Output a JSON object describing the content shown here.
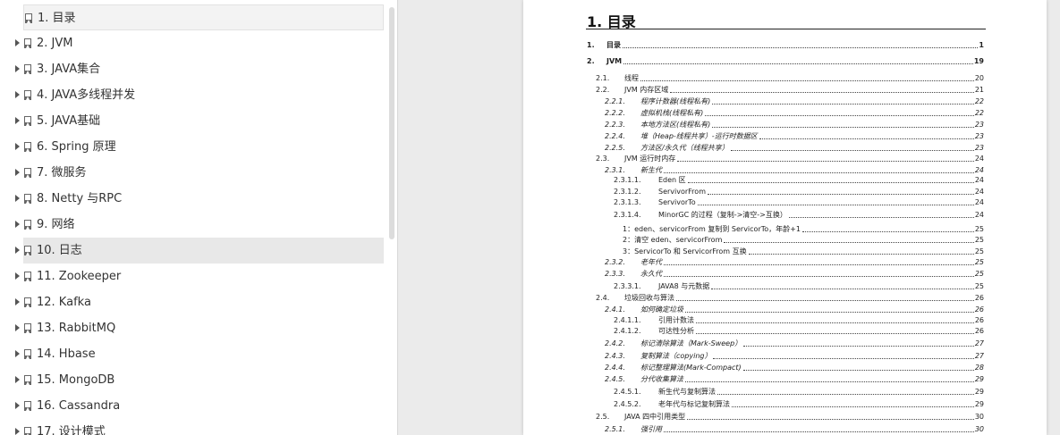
{
  "sidebar": {
    "items": [
      {
        "label": "1. 目录",
        "expandable": false,
        "state": "selected"
      },
      {
        "label": "2. JVM",
        "expandable": true
      },
      {
        "label": "3. JAVA集合",
        "expandable": true
      },
      {
        "label": "4. JAVA多线程并发",
        "expandable": true
      },
      {
        "label": "5. JAVA基础",
        "expandable": true
      },
      {
        "label": "6. Spring 原理",
        "expandable": true
      },
      {
        "label": "7.   微服务",
        "expandable": true
      },
      {
        "label": "8. Netty 与RPC",
        "expandable": true
      },
      {
        "label": "9. 网络",
        "expandable": true
      },
      {
        "label": "10. 日志",
        "expandable": true,
        "state": "hovered"
      },
      {
        "label": "11. Zookeeper",
        "expandable": true
      },
      {
        "label": "12. Kafka",
        "expandable": true
      },
      {
        "label": "13. RabbitMQ",
        "expandable": true
      },
      {
        "label": "14. Hbase",
        "expandable": true
      },
      {
        "label": "15. MongoDB",
        "expandable": true
      },
      {
        "label": "16. Cassandra",
        "expandable": true
      },
      {
        "label": "17. 设计模式",
        "expandable": true
      }
    ]
  },
  "document": {
    "title": "1. 目录",
    "toc": [
      {
        "num": "1.",
        "text": "目录",
        "page": "1",
        "style": "b",
        "level": 1
      },
      {
        "num": "2.",
        "text": "JVM",
        "page": "19",
        "style": "b",
        "level": 1
      },
      {
        "num": "2.1.",
        "text": "线程",
        "page": "20",
        "style": "",
        "level": 2
      },
      {
        "num": "2.2.",
        "text": "JVM 内存区域",
        "page": "21",
        "style": "",
        "level": 2
      },
      {
        "num": "2.2.1.",
        "text": "程序计数器(线程私有)",
        "page": "22",
        "style": "i",
        "level": 3
      },
      {
        "num": "2.2.2.",
        "text": "虚拟机栈(线程私有)",
        "page": "22",
        "style": "i",
        "level": 3
      },
      {
        "num": "2.2.3.",
        "text": "本地方法区(线程私有)",
        "page": "23",
        "style": "i",
        "level": 3
      },
      {
        "num": "2.2.4.",
        "text": "堆（Heap-线程共享）-运行时数据区",
        "page": "23",
        "style": "i",
        "level": 3
      },
      {
        "num": "2.2.5.",
        "text": "方法区/永久代（线程共享）",
        "page": "23",
        "style": "i",
        "level": 3
      },
      {
        "num": "2.3.",
        "text": "JVM 运行时内存",
        "page": "24",
        "style": "",
        "level": 2
      },
      {
        "num": "2.3.1.",
        "text": "新生代",
        "page": "24",
        "style": "i",
        "level": 3
      },
      {
        "num": "2.3.1.1.",
        "text": "Eden 区",
        "page": "24",
        "style": "",
        "level": 4
      },
      {
        "num": "2.3.1.2.",
        "text": "ServivorFrom",
        "page": "24",
        "style": "",
        "level": 4
      },
      {
        "num": "2.3.1.3.",
        "text": "ServivorTo",
        "page": "24",
        "style": "",
        "level": 4
      },
      {
        "num": "2.3.1.4.",
        "text": "MinorGC 的过程（复制->清空->互换）",
        "page": "24",
        "style": "",
        "level": 4
      },
      {
        "num": "1：",
        "text": "eden、servicorFrom 复制到 ServicorTo，年龄+1",
        "page": "25",
        "style": "",
        "level": 5
      },
      {
        "num": "2：",
        "text": "清空 eden、servicorFrom",
        "page": "25",
        "style": "",
        "level": 5
      },
      {
        "num": "3：",
        "text": "ServicorTo 和 ServicorFrom 互换",
        "page": "25",
        "style": "",
        "level": 5
      },
      {
        "num": "2.3.2.",
        "text": "老年代",
        "page": "25",
        "style": "i",
        "level": 3
      },
      {
        "num": "2.3.3.",
        "text": "永久代",
        "page": "25",
        "style": "i",
        "level": 3
      },
      {
        "num": "2.3.3.1.",
        "text": "JAVA8 与元数据",
        "page": "25",
        "style": "",
        "level": 4
      },
      {
        "num": "2.4.",
        "text": "垃圾回收与算法",
        "page": "26",
        "style": "",
        "level": 2
      },
      {
        "num": "2.4.1.",
        "text": "如何确定垃圾",
        "page": "26",
        "style": "i",
        "level": 3
      },
      {
        "num": "2.4.1.1.",
        "text": "引用计数法",
        "page": "26",
        "style": "",
        "level": 4
      },
      {
        "num": "2.4.1.2.",
        "text": "可达性分析",
        "page": "26",
        "style": "",
        "level": 4
      },
      {
        "num": "2.4.2.",
        "text": "标记清除算法（Mark-Sweep）",
        "page": "27",
        "style": "i",
        "level": 3
      },
      {
        "num": "2.4.3.",
        "text": "复制算法（copying）",
        "page": "27",
        "style": "i",
        "level": 3
      },
      {
        "num": "2.4.4.",
        "text": "标记整理算法(Mark-Compact)",
        "page": "28",
        "style": "i",
        "level": 3
      },
      {
        "num": "2.4.5.",
        "text": "分代收集算法",
        "page": "29",
        "style": "i",
        "level": 3
      },
      {
        "num": "2.4.5.1.",
        "text": "新生代与复制算法",
        "page": "29",
        "style": "",
        "level": 4
      },
      {
        "num": "2.4.5.2.",
        "text": "老年代与标记复制算法",
        "page": "29",
        "style": "",
        "level": 4
      },
      {
        "num": "2.5.",
        "text": "JAVA 四中引用类型",
        "page": "30",
        "style": "",
        "level": 2
      },
      {
        "num": "2.5.1.",
        "text": "强引用",
        "page": "30",
        "style": "i",
        "level": 3
      }
    ]
  }
}
